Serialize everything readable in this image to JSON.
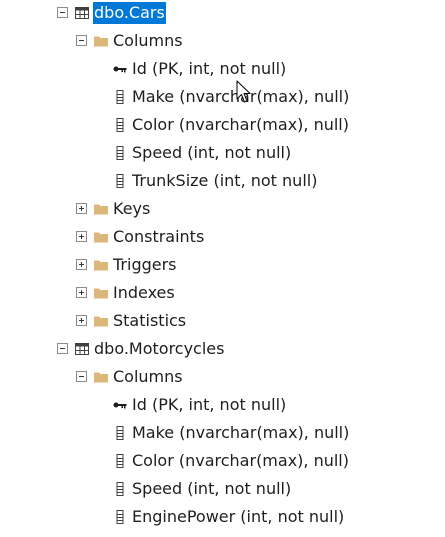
{
  "tree": {
    "tables": [
      {
        "name": "dbo.Cars",
        "selected": true,
        "columns_folder": "Columns",
        "columns": [
          {
            "label": "Id (PK, int, not null)",
            "icon": "key-icon"
          },
          {
            "label": "Make (nvarchar(max), null)",
            "icon": "column-icon"
          },
          {
            "label": "Color (nvarchar(max), null)",
            "icon": "column-icon"
          },
          {
            "label": "Speed (int, not null)",
            "icon": "column-icon"
          },
          {
            "label": "TrunkSize (int, not null)",
            "icon": "column-icon"
          }
        ],
        "folders": [
          "Keys",
          "Constraints",
          "Triggers",
          "Indexes",
          "Statistics"
        ]
      },
      {
        "name": "dbo.Motorcycles",
        "selected": false,
        "columns_folder": "Columns",
        "columns": [
          {
            "label": "Id (PK, int, not null)",
            "icon": "key-icon"
          },
          {
            "label": "Make (nvarchar(max), null)",
            "icon": "column-icon"
          },
          {
            "label": "Color (nvarchar(max), null)",
            "icon": "column-icon"
          },
          {
            "label": "Speed (int, not null)",
            "icon": "column-icon"
          },
          {
            "label": "EnginePower (int, not null)",
            "icon": "column-icon"
          }
        ]
      }
    ]
  },
  "colors": {
    "selection": "#0078d7",
    "folder": "#dcb67a",
    "text": "#1e1e1e"
  }
}
